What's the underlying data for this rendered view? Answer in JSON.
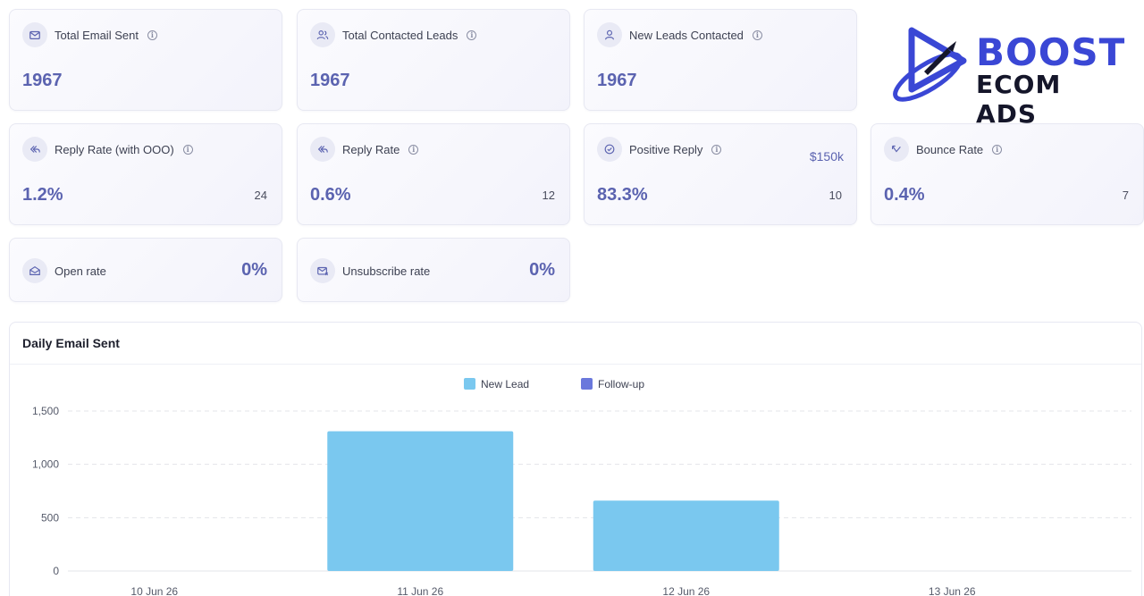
{
  "cards": {
    "total_email_sent": {
      "label": "Total Email Sent",
      "value": "1967"
    },
    "total_contacted_leads": {
      "label": "Total Contacted Leads",
      "value": "1967"
    },
    "new_leads_contacted": {
      "label": "New Leads Contacted",
      "value": "1967"
    },
    "reply_rate_ooo": {
      "label": "Reply Rate (with OOO)",
      "value": "1.2%",
      "count": "24"
    },
    "reply_rate": {
      "label": "Reply Rate",
      "value": "0.6%",
      "count": "12"
    },
    "positive_reply": {
      "label": "Positive Reply",
      "value": "83.3%",
      "count": "10",
      "extra": "$150k"
    },
    "bounce_rate": {
      "label": "Bounce Rate",
      "value": "0.4%",
      "count": "7"
    },
    "open_rate": {
      "label": "Open rate",
      "value": "0%"
    },
    "unsubscribe_rate": {
      "label": "Unsubscribe rate",
      "value": "0%"
    }
  },
  "logo": {
    "line1": "BOOST",
    "line2": "ECOM ADS"
  },
  "chart": {
    "title": "Daily Email Sent"
  },
  "chart_data": {
    "type": "bar",
    "stacked": true,
    "categories": [
      "10 Jun 26",
      "11 Jun 26",
      "12 Jun 26",
      "13 Jun 26"
    ],
    "series": [
      {
        "name": "New Lead",
        "color": "#7ac8ef",
        "values": [
          0,
          1310,
          660,
          0
        ]
      },
      {
        "name": "Follow-up",
        "color": "#6a78dc",
        "values": [
          0,
          0,
          0,
          0
        ]
      }
    ],
    "yticks": [
      0,
      500,
      1000,
      1500
    ],
    "ytick_labels": [
      "0",
      "500",
      "1,000",
      "1,500"
    ],
    "ylim": [
      0,
      1500
    ],
    "grid": true,
    "legend": "top-center"
  },
  "colors": {
    "accent": "#5b63b0",
    "icon_bg": "#e9eaf5"
  }
}
